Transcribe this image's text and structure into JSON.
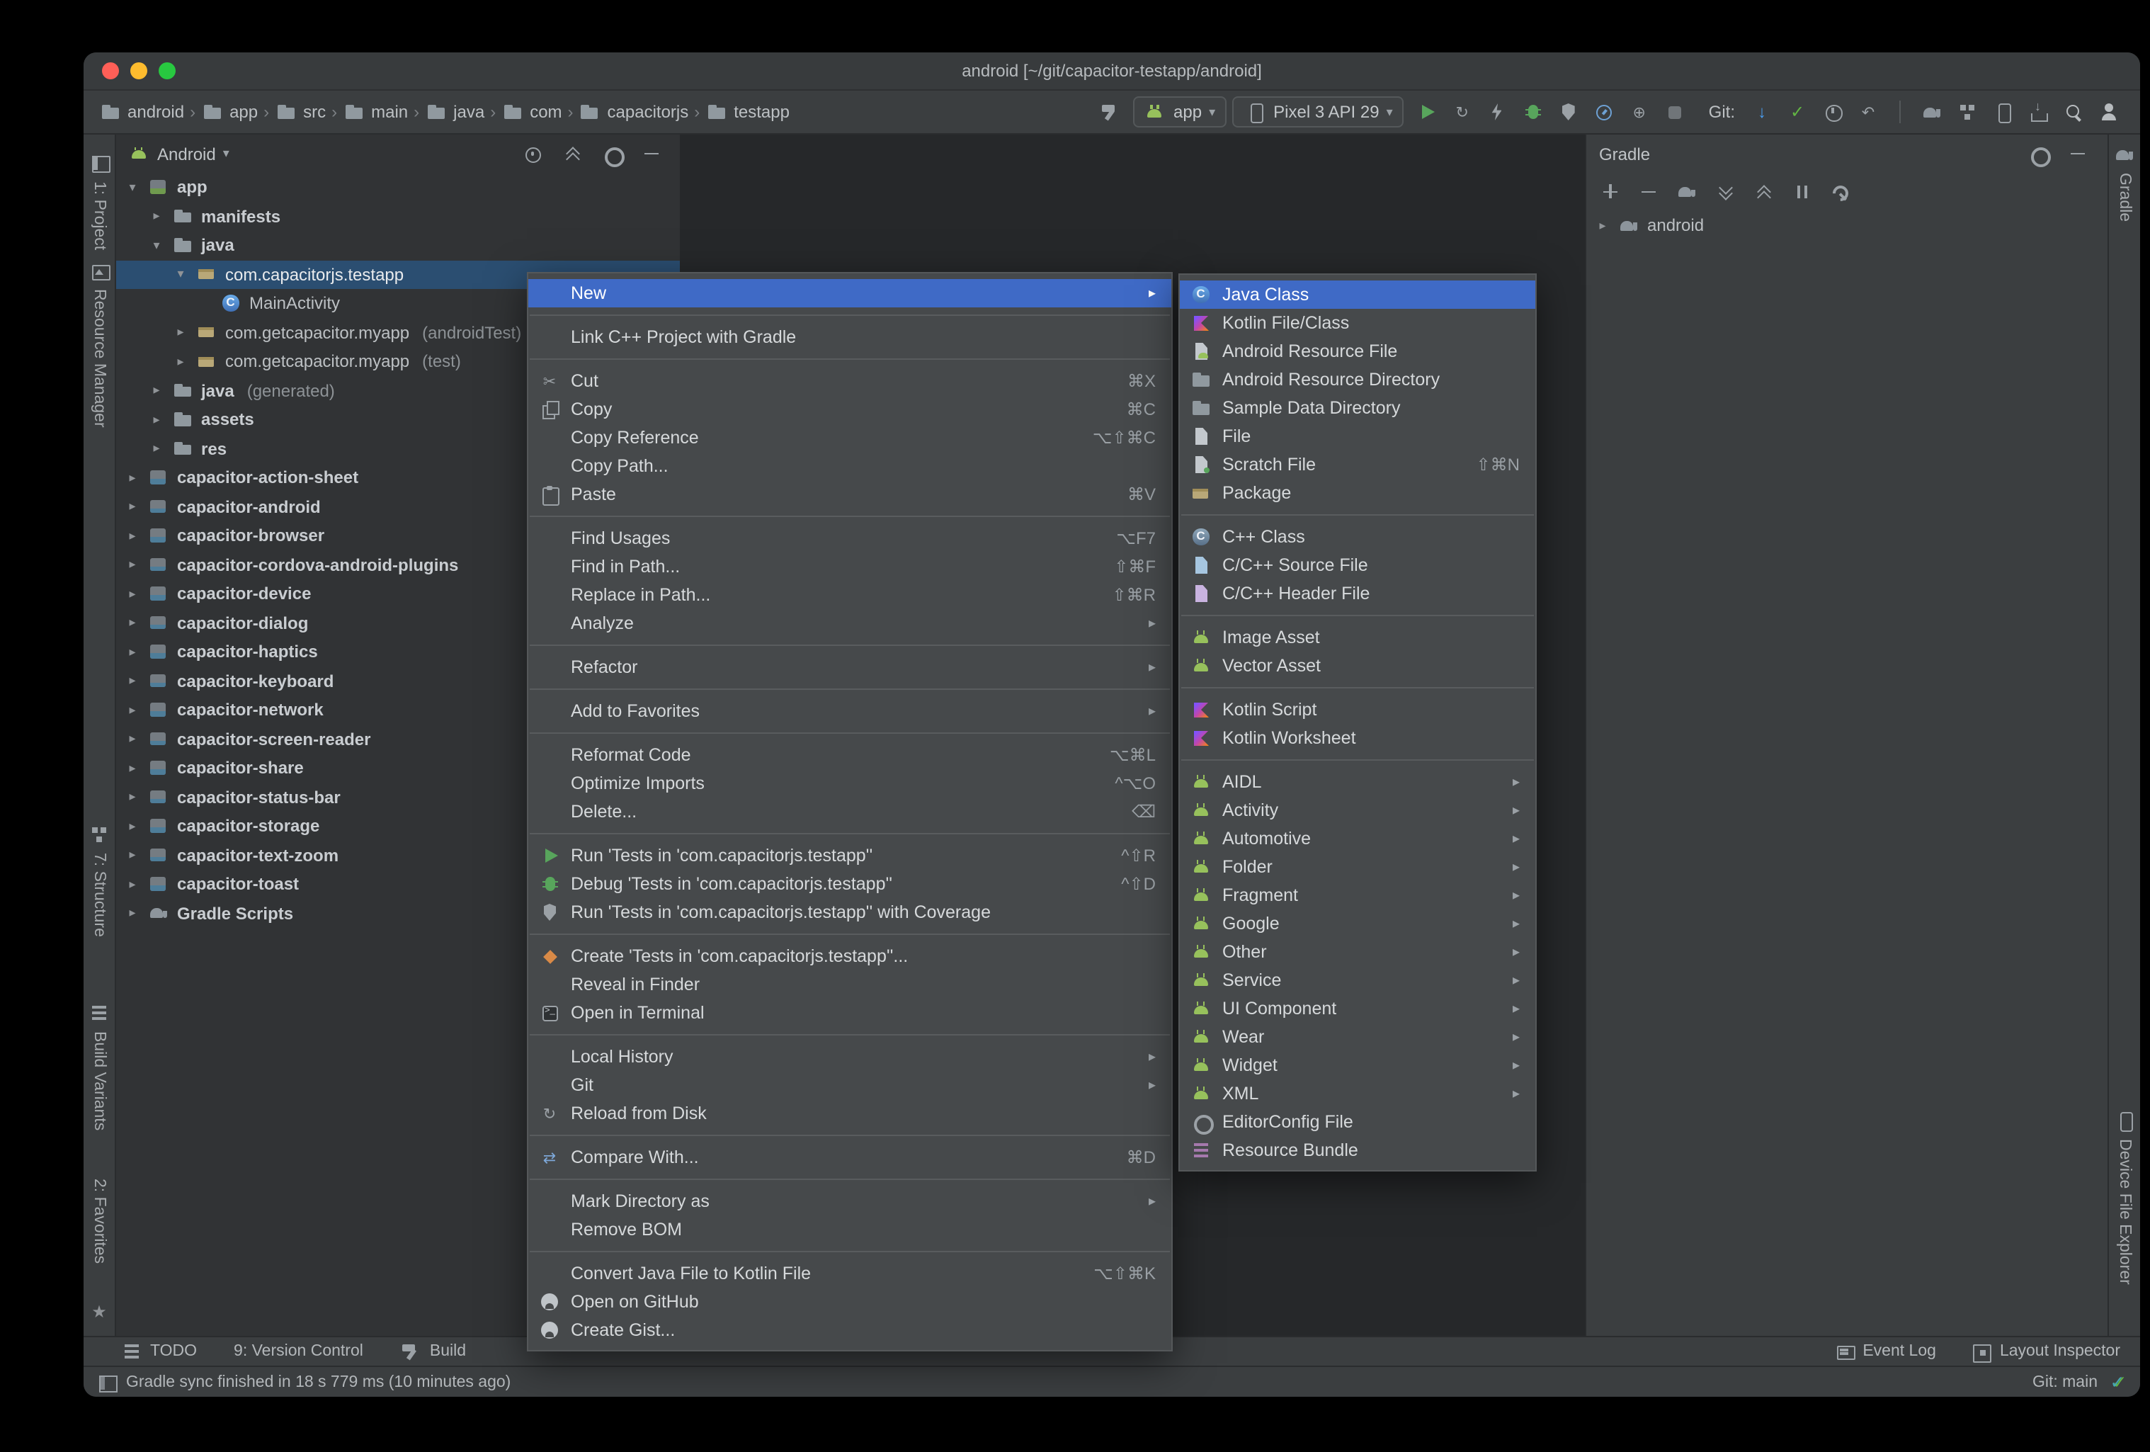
{
  "window": {
    "title": "android [~/git/capacitor-testapp/android]"
  },
  "colors": {
    "menu_selection_blue": "#3f6ac6",
    "tree_selection_blue": "#2b4e71",
    "android_green": "#97c15c",
    "run_green": "#58a55c",
    "update_blue": "#4a9df0",
    "commit_green": "#62b543"
  },
  "toolbar": {
    "breadcrumbs": [
      "android",
      "app",
      "src",
      "main",
      "java",
      "com",
      "capacitorjs",
      "testapp"
    ],
    "run_config": {
      "label": "app"
    },
    "device": {
      "label": "Pixel 3 API 29"
    },
    "git_label": "Git:",
    "left_actions": [
      {
        "name": "build-project-button",
        "icon": "hammer"
      }
    ],
    "run_actions": [
      {
        "name": "run-button",
        "icon": "play"
      },
      {
        "name": "apply-changes-button",
        "icon": "apply-changes"
      },
      {
        "name": "apply-code-changes-button",
        "icon": "bolt"
      },
      {
        "name": "debug-button",
        "icon": "debug"
      },
      {
        "name": "run-with-coverage-button",
        "icon": "coverage"
      },
      {
        "name": "profiler-button",
        "icon": "profiler"
      },
      {
        "name": "attach-debugger-button",
        "icon": "attach"
      },
      {
        "name": "stop-button",
        "icon": "stop"
      }
    ],
    "vcs_actions": [
      {
        "name": "update-project-button",
        "icon": "vcs-update"
      },
      {
        "name": "commit-button",
        "icon": "vcs-commit"
      },
      {
        "name": "show-history-button",
        "icon": "clock"
      },
      {
        "name": "rollback-button",
        "icon": "rollback"
      }
    ],
    "right_actions": [
      {
        "name": "sync-project-with-gradle-button",
        "icon": "gradle"
      },
      {
        "name": "project-structure-button",
        "icon": "structure"
      },
      {
        "name": "virtual-device-manager-button",
        "icon": "phone"
      },
      {
        "name": "sdk-manager-button",
        "icon": "sdk"
      },
      {
        "name": "search-everywhere-button",
        "icon": "search"
      },
      {
        "name": "profile-avatar-button",
        "icon": "avatar"
      }
    ]
  },
  "left_stripe": {
    "top": [
      {
        "label": "1: Project",
        "icon": "project-pane"
      },
      {
        "label": "Resource Manager",
        "icon": "image"
      }
    ],
    "bottom": [
      {
        "label": "7: Structure",
        "icon": "structure"
      },
      {
        "label": "Build Variants",
        "icon": "layers"
      },
      {
        "label": "2: Favorites",
        "icon": null
      }
    ],
    "star_glyph": "★"
  },
  "right_stripe": {
    "top": [
      {
        "label": "Gradle",
        "icon": "gradle"
      }
    ],
    "bottom": [
      {
        "label": "Device File Explorer",
        "icon": "phone"
      }
    ]
  },
  "project_panel": {
    "view": "Android",
    "header_actions": [
      {
        "name": "locate-selected-file-button",
        "icon": "target"
      },
      {
        "name": "collapse-all-button",
        "icon": "collapse"
      },
      {
        "name": "view-options-button",
        "icon": "gear"
      },
      {
        "name": "hide-panel-button",
        "icon": "minus"
      }
    ],
    "tree": [
      {
        "label": "app",
        "depth": 0,
        "arrow": "open",
        "icon": "module-app",
        "bold": true
      },
      {
        "label": "manifests",
        "depth": 1,
        "arrow": "closed",
        "icon": "folder",
        "bold": true
      },
      {
        "label": "java",
        "depth": 1,
        "arrow": "open",
        "icon": "folder",
        "bold": true
      },
      {
        "label": "com.capacitorjs.testapp",
        "depth": 2,
        "arrow": "open",
        "icon": "package",
        "selected": true
      },
      {
        "label": "MainActivity",
        "depth": 3,
        "arrow": null,
        "icon": "class"
      },
      {
        "label": "com.getcapacitor.myapp",
        "suffix": "(androidTest)",
        "depth": 2,
        "arrow": "closed",
        "icon": "package"
      },
      {
        "label": "com.getcapacitor.myapp",
        "suffix": "(test)",
        "depth": 2,
        "arrow": "closed",
        "icon": "package"
      },
      {
        "label": "java",
        "suffix": "(generated)",
        "depth": 1,
        "arrow": "closed",
        "icon": "folder",
        "bold": true
      },
      {
        "label": "assets",
        "depth": 1,
        "arrow": "closed",
        "icon": "folder",
        "bold": true
      },
      {
        "label": "res",
        "depth": 1,
        "arrow": "closed",
        "icon": "folder",
        "bold": true
      },
      {
        "label": "capacitor-action-sheet",
        "depth": 0,
        "arrow": "closed",
        "icon": "module",
        "bold": true
      },
      {
        "label": "capacitor-android",
        "depth": 0,
        "arrow": "closed",
        "icon": "module",
        "bold": true
      },
      {
        "label": "capacitor-browser",
        "depth": 0,
        "arrow": "closed",
        "icon": "module",
        "bold": true
      },
      {
        "label": "capacitor-cordova-android-plugins",
        "depth": 0,
        "arrow": "closed",
        "icon": "module",
        "bold": true
      },
      {
        "label": "capacitor-device",
        "depth": 0,
        "arrow": "closed",
        "icon": "module",
        "bold": true
      },
      {
        "label": "capacitor-dialog",
        "depth": 0,
        "arrow": "closed",
        "icon": "module",
        "bold": true
      },
      {
        "label": "capacitor-haptics",
        "depth": 0,
        "arrow": "closed",
        "icon": "module",
        "bold": true
      },
      {
        "label": "capacitor-keyboard",
        "depth": 0,
        "arrow": "closed",
        "icon": "module",
        "bold": true
      },
      {
        "label": "capacitor-network",
        "depth": 0,
        "arrow": "closed",
        "icon": "module",
        "bold": true
      },
      {
        "label": "capacitor-screen-reader",
        "depth": 0,
        "arrow": "closed",
        "icon": "module",
        "bold": true
      },
      {
        "label": "capacitor-share",
        "depth": 0,
        "arrow": "closed",
        "icon": "module",
        "bold": true
      },
      {
        "label": "capacitor-status-bar",
        "depth": 0,
        "arrow": "closed",
        "icon": "module",
        "bold": true
      },
      {
        "label": "capacitor-storage",
        "depth": 0,
        "arrow": "closed",
        "icon": "module",
        "bold": true
      },
      {
        "label": "capacitor-text-zoom",
        "depth": 0,
        "arrow": "closed",
        "icon": "module",
        "bold": true
      },
      {
        "label": "capacitor-toast",
        "depth": 0,
        "arrow": "closed",
        "icon": "module",
        "bold": true
      },
      {
        "label": "Gradle Scripts",
        "depth": 0,
        "arrow": "closed",
        "icon": "gradle",
        "bold": true
      }
    ]
  },
  "context_menu": {
    "items": [
      {
        "label": "New",
        "submenu": true,
        "selected": true
      },
      {
        "type": "sep"
      },
      {
        "label": "Link C++ Project with Gradle"
      },
      {
        "type": "sep"
      },
      {
        "label": "Cut",
        "shortcut": "⌘X",
        "icon": "cut"
      },
      {
        "label": "Copy",
        "shortcut": "⌘C",
        "icon": "copy"
      },
      {
        "label": "Copy Reference",
        "shortcut": "⌥⇧⌘C"
      },
      {
        "label": "Copy Path..."
      },
      {
        "label": "Paste",
        "shortcut": "⌘V",
        "icon": "paste"
      },
      {
        "type": "sep"
      },
      {
        "label": "Find Usages",
        "shortcut": "⌥F7"
      },
      {
        "label": "Find in Path...",
        "shortcut": "⇧⌘F"
      },
      {
        "label": "Replace in Path...",
        "shortcut": "⇧⌘R"
      },
      {
        "label": "Analyze",
        "submenu": true
      },
      {
        "type": "sep"
      },
      {
        "label": "Refactor",
        "submenu": true
      },
      {
        "type": "sep"
      },
      {
        "label": "Add to Favorites",
        "submenu": true
      },
      {
        "type": "sep"
      },
      {
        "label": "Reformat Code",
        "shortcut": "⌥⌘L"
      },
      {
        "label": "Optimize Imports",
        "shortcut": "^⌥O"
      },
      {
        "label": "Delete...",
        "shortcut": "⌫"
      },
      {
        "type": "sep"
      },
      {
        "label": "Run 'Tests in 'com.capacitorjs.testapp''",
        "shortcut": "^⇧R",
        "icon": "run"
      },
      {
        "label": "Debug 'Tests in 'com.capacitorjs.testapp''",
        "shortcut": "^⇧D",
        "icon": "debug"
      },
      {
        "label": "Run 'Tests in 'com.capacitorjs.testapp'' with Coverage",
        "icon": "coverage"
      },
      {
        "type": "sep"
      },
      {
        "label": "Create 'Tests in 'com.capacitorjs.testapp''...",
        "icon": "new-test"
      },
      {
        "label": "Reveal in Finder"
      },
      {
        "label": "Open in Terminal",
        "icon": "terminal"
      },
      {
        "type": "sep"
      },
      {
        "label": "Local History",
        "submenu": true
      },
      {
        "label": "Git",
        "submenu": true
      },
      {
        "label": "Reload from Disk",
        "icon": "refresh"
      },
      {
        "type": "sep"
      },
      {
        "label": "Compare With...",
        "shortcut": "⌘D",
        "icon": "compare"
      },
      {
        "type": "sep"
      },
      {
        "label": "Mark Directory as",
        "submenu": true
      },
      {
        "label": "Remove BOM"
      },
      {
        "type": "sep"
      },
      {
        "label": "Convert Java File to Kotlin File",
        "shortcut": "⌥⇧⌘K"
      },
      {
        "label": "Open on GitHub",
        "icon": "github"
      },
      {
        "label": "Create Gist...",
        "icon": "github"
      }
    ]
  },
  "new_submenu": {
    "items": [
      {
        "label": "Java Class",
        "icon": "java-class",
        "selected": true
      },
      {
        "label": "Kotlin File/Class",
        "icon": "kotlin"
      },
      {
        "label": "Android Resource File",
        "icon": "android-file"
      },
      {
        "label": "Android Resource Directory",
        "icon": "folder"
      },
      {
        "label": "Sample Data Directory",
        "icon": "folder"
      },
      {
        "label": "File",
        "icon": "file"
      },
      {
        "label": "Scratch File",
        "shortcut": "⇧⌘N",
        "icon": "scratch"
      },
      {
        "label": "Package",
        "icon": "package"
      },
      {
        "type": "sep"
      },
      {
        "label": "C++ Class",
        "icon": "cpp-class"
      },
      {
        "label": "C/C++ Source File",
        "icon": "cpp-source"
      },
      {
        "label": "C/C++ Header File",
        "icon": "cpp-header"
      },
      {
        "type": "sep"
      },
      {
        "label": "Image Asset",
        "icon": "android"
      },
      {
        "label": "Vector Asset",
        "icon": "android"
      },
      {
        "type": "sep"
      },
      {
        "label": "Kotlin Script",
        "icon": "kotlin"
      },
      {
        "label": "Kotlin Worksheet",
        "icon": "kotlin"
      },
      {
        "type": "sep"
      },
      {
        "label": "AIDL",
        "icon": "android",
        "submenu": true
      },
      {
        "label": "Activity",
        "icon": "android",
        "submenu": true
      },
      {
        "label": "Automotive",
        "icon": "android",
        "submenu": true
      },
      {
        "label": "Folder",
        "icon": "android",
        "submenu": true
      },
      {
        "label": "Fragment",
        "icon": "android",
        "submenu": true
      },
      {
        "label": "Google",
        "icon": "android",
        "submenu": true
      },
      {
        "label": "Other",
        "icon": "android",
        "submenu": true
      },
      {
        "label": "Service",
        "icon": "android",
        "submenu": true
      },
      {
        "label": "UI Component",
        "icon": "android",
        "submenu": true
      },
      {
        "label": "Wear",
        "icon": "android",
        "submenu": true
      },
      {
        "label": "Widget",
        "icon": "android",
        "submenu": true
      },
      {
        "label": "XML",
        "icon": "android",
        "submenu": true
      },
      {
        "label": "EditorConfig File",
        "icon": "gear"
      },
      {
        "label": "Resource Bundle",
        "icon": "bundle"
      }
    ]
  },
  "gradle_panel": {
    "title": "Gradle",
    "header_actions": [
      {
        "name": "gradle-settings-button",
        "icon": "gear"
      },
      {
        "name": "hide-gradle-panel-button",
        "icon": "minus"
      }
    ],
    "toolbar": [
      {
        "name": "add-gradle-project-button",
        "icon": "plus"
      },
      {
        "name": "remove-gradle-project-button",
        "icon": "minus"
      },
      {
        "name": "sync-gradle-button",
        "icon": "gradle"
      },
      {
        "name": "expand-all-button",
        "icon": "expand"
      },
      {
        "name": "collapse-all-button",
        "icon": "collapse"
      },
      {
        "name": "offline-mode-button",
        "icon": "offline"
      },
      {
        "name": "gradle-settings-wrench-button",
        "icon": "wrench"
      }
    ],
    "tree": [
      {
        "label": "android",
        "icon": "gradle"
      }
    ]
  },
  "toolwindow_bar": {
    "left": [
      {
        "label": "TODO",
        "icon": "layers"
      },
      {
        "label": "9: Version Control",
        "icon": null
      },
      {
        "label": "Build",
        "icon": "hammer"
      }
    ],
    "right": [
      {
        "label": "Event Log",
        "icon": "event-log"
      },
      {
        "label": "Layout Inspector",
        "icon": "layout-inspector"
      }
    ]
  },
  "status_bar": {
    "message": "Gradle sync finished in 18 s 779 ms (10 minutes ago)",
    "git_branch": "Git: main"
  }
}
